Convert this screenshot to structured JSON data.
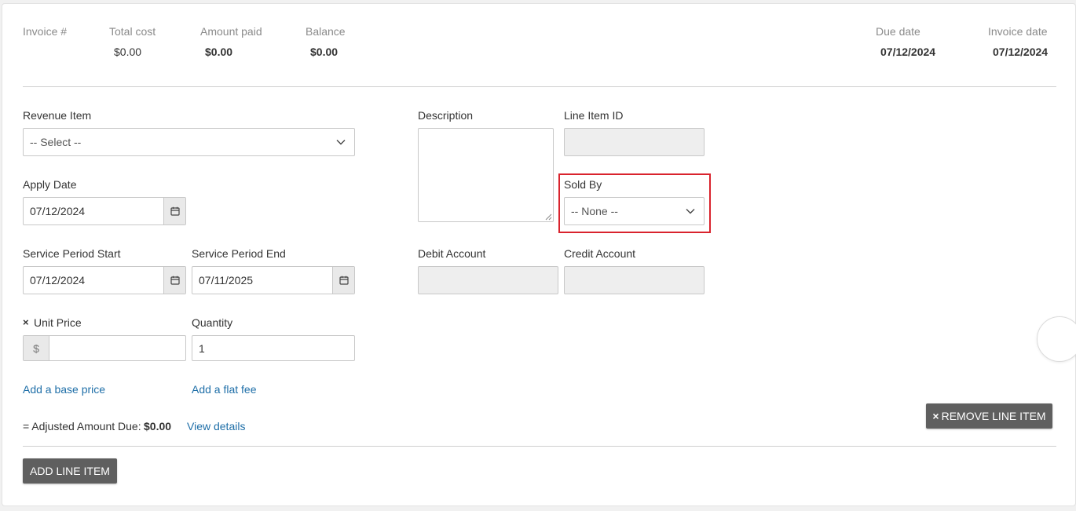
{
  "summary": {
    "invoice_label": "Invoice #",
    "total_cost_label": "Total cost",
    "total_cost_value": "$0.00",
    "amount_paid_label": "Amount paid",
    "amount_paid_value": "$0.00",
    "balance_label": "Balance",
    "balance_value": "$0.00",
    "due_date_label": "Due date",
    "due_date_value": "07/12/2024",
    "invoice_date_label": "Invoice date",
    "invoice_date_value": "07/12/2024"
  },
  "form": {
    "revenue_item": {
      "label": "Revenue Item",
      "value": "-- Select --"
    },
    "description": {
      "label": "Description",
      "value": ""
    },
    "line_item_id": {
      "label": "Line Item ID",
      "value": ""
    },
    "apply_date": {
      "label": "Apply Date",
      "value": "07/12/2024"
    },
    "sold_by": {
      "label": "Sold By",
      "value": "-- None --"
    },
    "service_period_start": {
      "label": "Service Period Start",
      "value": "07/12/2024"
    },
    "service_period_end": {
      "label": "Service Period End",
      "value": "07/11/2025"
    },
    "debit_account": {
      "label": "Debit Account",
      "value": ""
    },
    "credit_account": {
      "label": "Credit Account",
      "value": ""
    },
    "unit_price": {
      "required_mark": "×",
      "label": "Unit Price",
      "prefix": "$",
      "value": ""
    },
    "quantity": {
      "label": "Quantity",
      "value": "1"
    }
  },
  "links": {
    "add_base_price": "Add a base price",
    "add_flat_fee": "Add a flat fee",
    "view_details": "View details"
  },
  "adjusted": {
    "label": "= Adjusted Amount Due:",
    "value": "$0.00"
  },
  "buttons": {
    "remove_line_item": "REMOVE LINE ITEM",
    "remove_icon": "×",
    "add_line_item": "ADD LINE ITEM"
  },
  "colors": {
    "highlight": "#d9232d",
    "link": "#1f6fa8",
    "button": "#5f5f5f"
  }
}
